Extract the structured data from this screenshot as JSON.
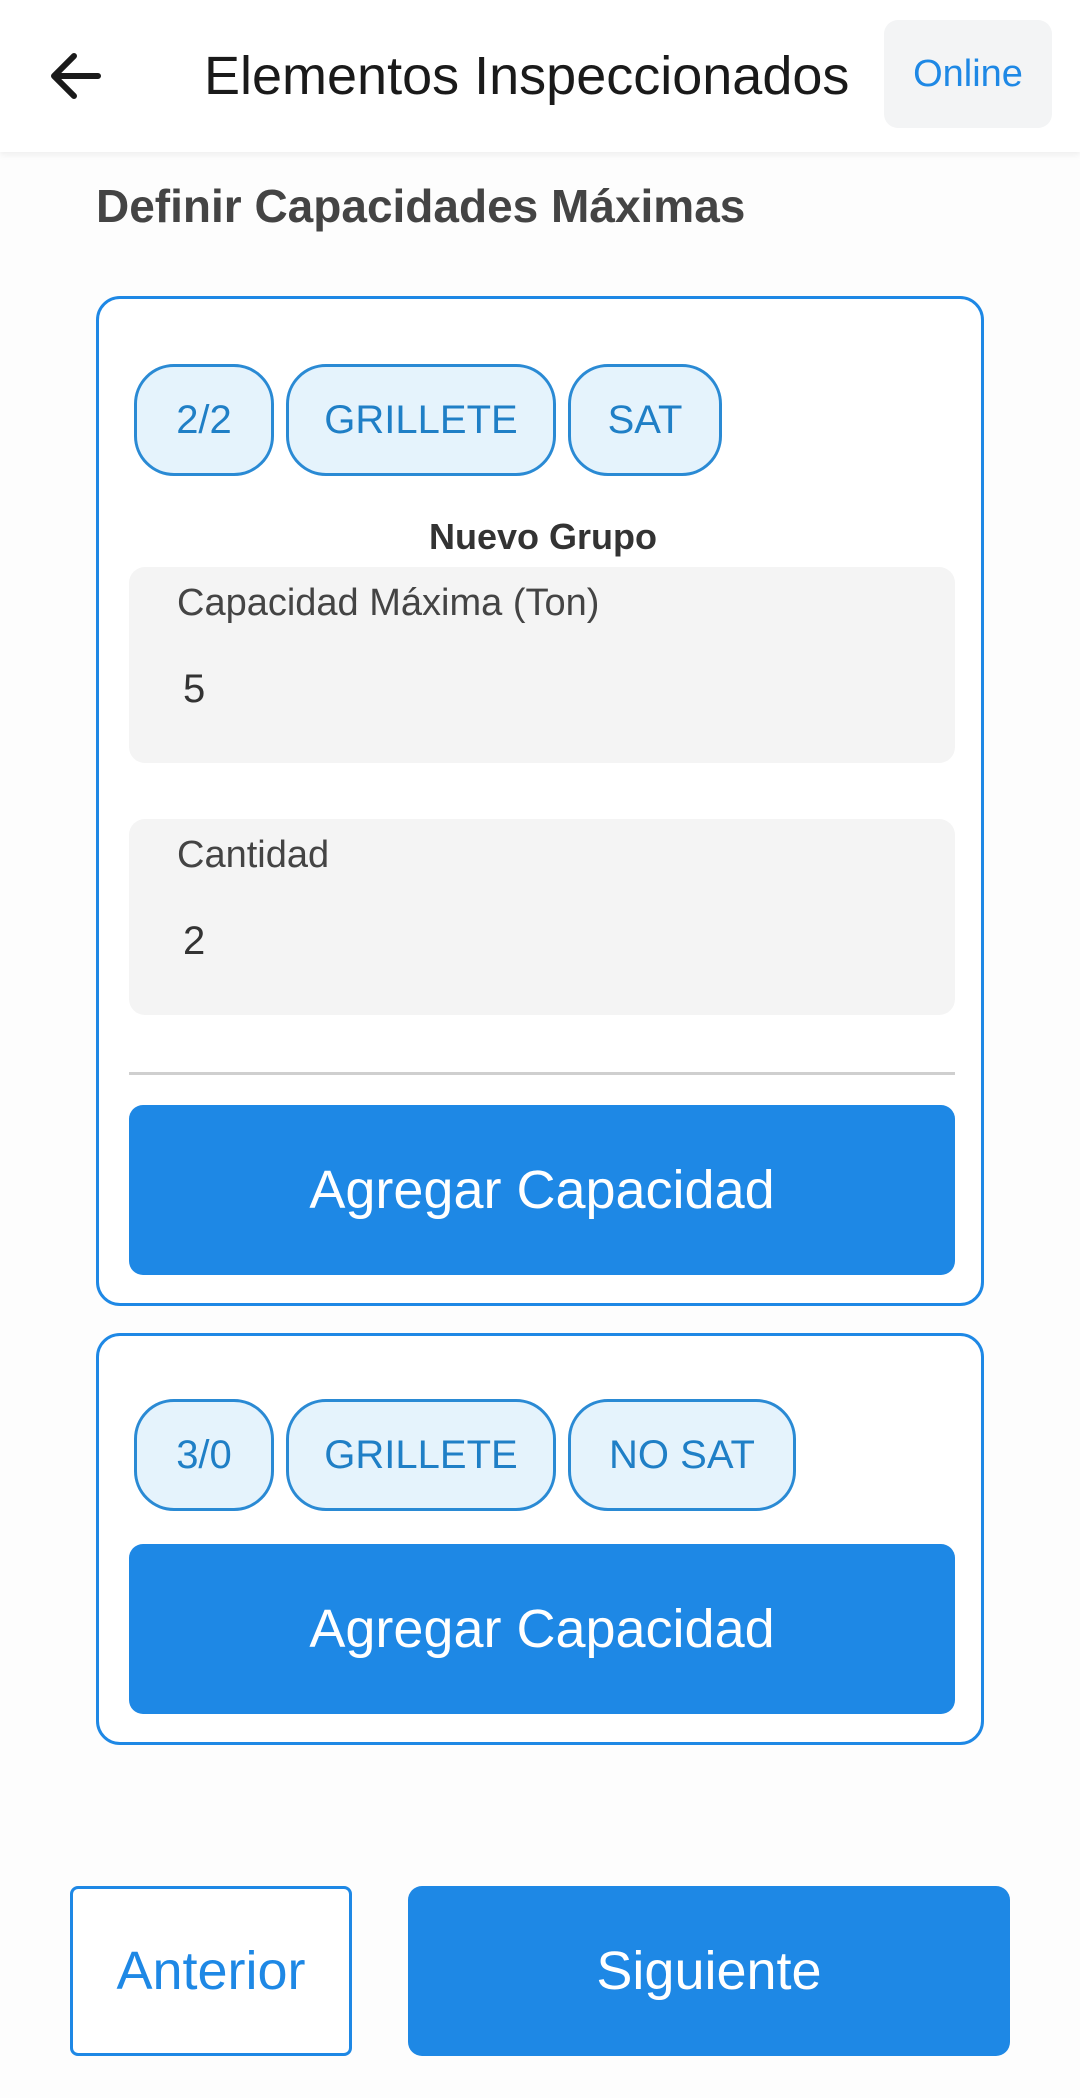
{
  "header": {
    "title": "Elementos Inspeccionados",
    "status": "Online",
    "back_icon": "arrow-left-icon"
  },
  "section_title": "Definir Capacidades Máximas",
  "cards": [
    {
      "chips": [
        "2/2",
        "GRILLETE",
        "SAT"
      ],
      "group_label": "Nuevo Grupo",
      "fields": [
        {
          "label": "Capacidad Máxima (Ton)",
          "value": "5"
        },
        {
          "label": "Cantidad",
          "value": "2"
        }
      ],
      "button_label": "Agregar Capacidad"
    },
    {
      "chips": [
        "3/0",
        "GRILLETE",
        "NO SAT"
      ],
      "button_label": "Agregar Capacidad"
    }
  ],
  "footer": {
    "prev_label": "Anterior",
    "next_label": "Siguiente"
  },
  "colors": {
    "accent": "#1e88e5",
    "chip_background": "#e5f3fc"
  }
}
